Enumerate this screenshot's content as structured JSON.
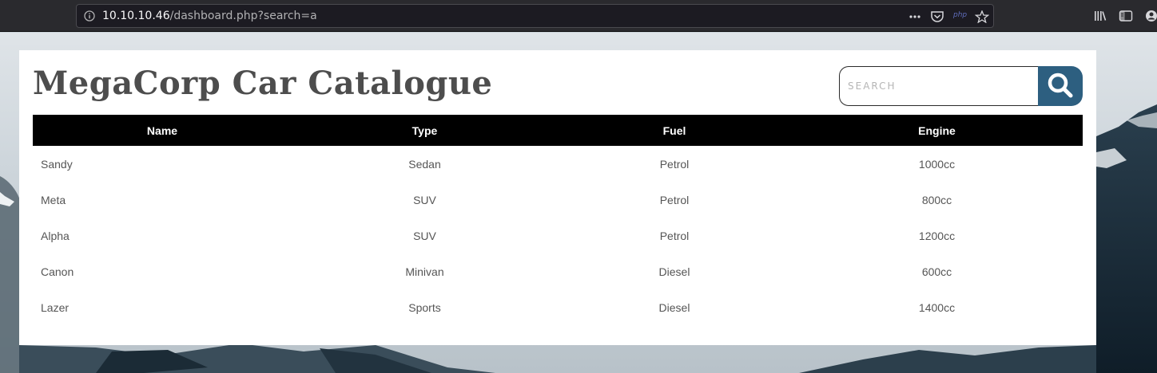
{
  "browser": {
    "url_host": "10.10.10.46",
    "url_path": "/dashboard.php?search=a",
    "php_badge": "php"
  },
  "page": {
    "title": "MegaCorp Car Catalogue",
    "search": {
      "placeholder": "SEARCH",
      "value": ""
    },
    "accent_color": "#2d5f80"
  },
  "table": {
    "headers": [
      "Name",
      "Type",
      "Fuel",
      "Engine"
    ],
    "rows": [
      [
        "Sandy",
        "Sedan",
        "Petrol",
        "1000cc"
      ],
      [
        "Meta",
        "SUV",
        "Petrol",
        "800cc"
      ],
      [
        "Alpha",
        "SUV",
        "Petrol",
        "1200cc"
      ],
      [
        "Canon",
        "Minivan",
        "Diesel",
        "600cc"
      ],
      [
        "Lazer",
        "Sports",
        "Diesel",
        "1400cc"
      ]
    ]
  }
}
